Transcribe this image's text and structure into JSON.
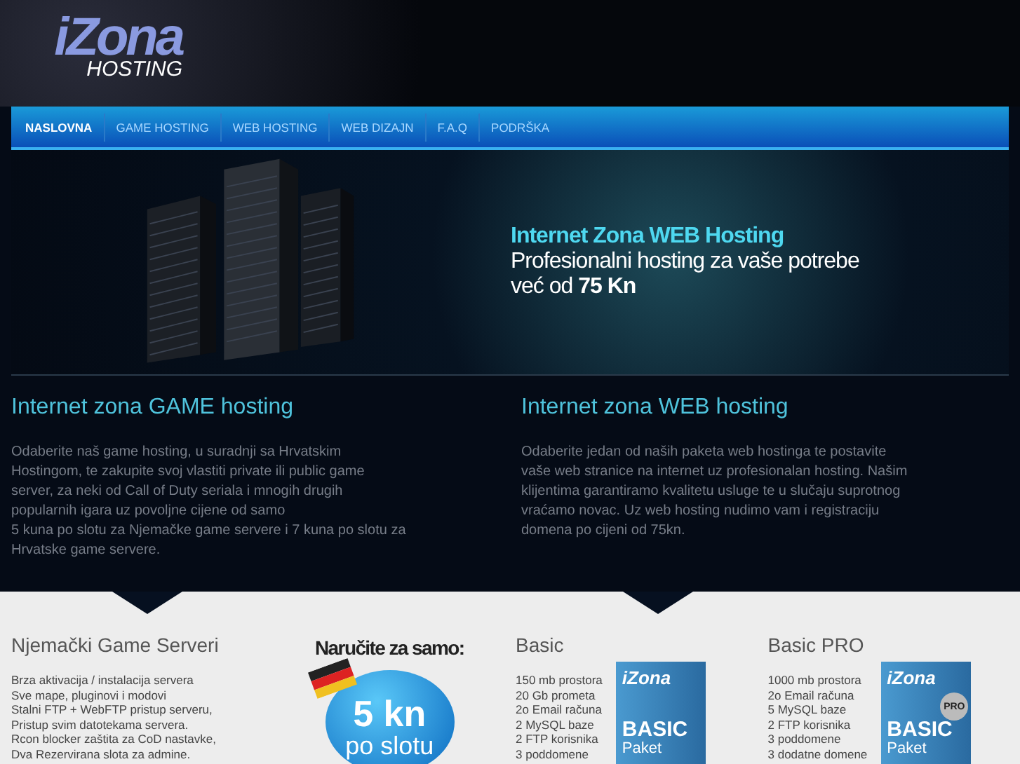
{
  "logo": {
    "main": "iZona",
    "sub": "HOSTING"
  },
  "nav": [
    {
      "label": "NASLOVNA",
      "selected": true
    },
    {
      "label": "GAME HOSTING",
      "selected": false
    },
    {
      "label": "WEB HOSTING",
      "selected": false
    },
    {
      "label": "WEB DIZAJN",
      "selected": false
    },
    {
      "label": "F.A.Q",
      "selected": false
    },
    {
      "label": "PODRŠKA",
      "selected": false
    }
  ],
  "banner": {
    "title": "Internet Zona WEB Hosting",
    "line": "Profesionalni hosting za vaše potrebe",
    "price": "već od **75 Kn**"
  },
  "intro": [
    {
      "title": "Internet zona GAME hosting",
      "text": "Odaberite naš game hosting, u suradnji sa Hrvatskim Hostingom, te zakupite svoj vlastiti private ili public game server, za neki od Call of Duty seriala i mnogih drugih popularnih igara uz povoljne cijene od samo\n5 kuna po slotu za Njemačke game servere i 7 kuna po slotu za Hrvatske game servere."
    },
    {
      "title": "Internet zona WEB hosting",
      "text": "Odaberite jedan od naših paketa web hostinga te postavite vaše web stranice na internet uz profesionalan hosting. Našim klijentima garantiramo kvalitetu usluge te u slučaju suprotnog vraćamo novac. Uz web hosting nudimo vam i registraciju domena po cijeni od 75kn."
    }
  ],
  "offers": [
    {
      "kind": "list",
      "title": "Njemački Game Serveri",
      "items": [
        "Brza aktivacija / instalacija servera",
        "Sve mape, pluginovi i modovi",
        "Stalni FTP + WebFTP pristup serveru,",
        "Pristup svim datotekama servera.",
        "Rcon blocker zaštita za CoD nastavke,",
        "Dva Rezervirana slota za admine."
      ]
    },
    {
      "kind": "promo",
      "title": "Naručite za samo:",
      "price": "5 kn",
      "unit": "po slotu"
    },
    {
      "kind": "package",
      "title": "Basic",
      "items": [
        "150 mb prostora",
        "20 Gb prometa",
        "2o Email računa",
        "2 MySQL baze",
        "2 FTP korisnika",
        "3 poddomene"
      ],
      "box": {
        "logo": "iZona",
        "name": "BASIC",
        "sub": "Paket"
      }
    },
    {
      "kind": "package",
      "title": "Basic PRO",
      "items": [
        "1000 mb prostora",
        "2o Email računa",
        "5 MySQL baze",
        "2 FTP korisnika",
        "3 poddomene",
        "3 dodatne domene"
      ],
      "box": {
        "logo": "iZona",
        "name": "BASIC",
        "sub": "Paket",
        "badge": "PRO"
      }
    }
  ]
}
